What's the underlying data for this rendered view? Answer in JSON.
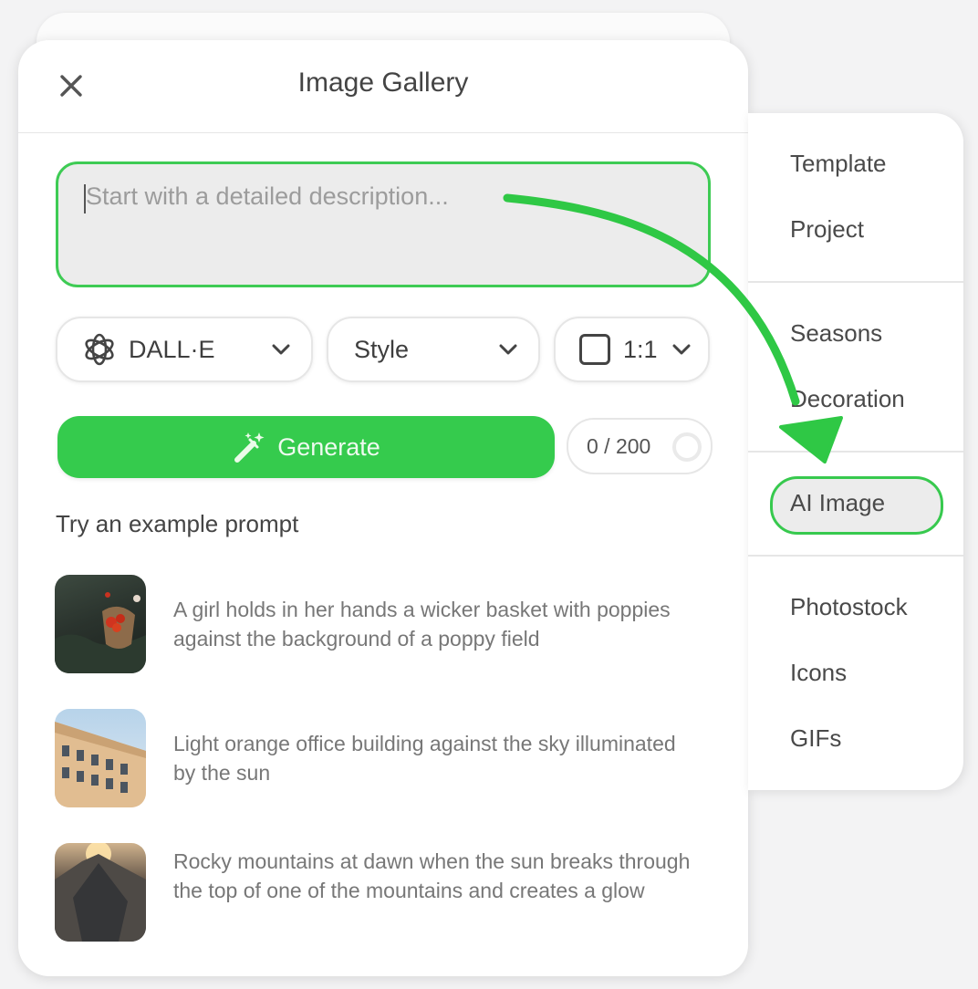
{
  "modal": {
    "title": "Image Gallery",
    "prompt": {
      "placeholder": "Start with a detailed description...",
      "value": ""
    },
    "model_select": {
      "label": "DALL·E",
      "icon": "openai-logo-icon"
    },
    "style_select": {
      "label": "Style"
    },
    "ratio_select": {
      "label": "1:1"
    },
    "generate_button": {
      "label": "Generate",
      "icon": "magic-wand-icon"
    },
    "counter": {
      "label": "0 / 200",
      "used": 0,
      "max": 200
    },
    "examples_heading": "Try an example prompt",
    "examples": [
      {
        "text": "A girl holds in her hands a wicker basket with poppies against the background of a poppy field"
      },
      {
        "text": "Light orange office building against the sky illuminated by the sun"
      },
      {
        "text": "Rocky mountains at dawn when the sun breaks through the top of one of the mountains and creates a glow"
      }
    ]
  },
  "side_menu": {
    "groups": [
      {
        "items": [
          "Template",
          "Project"
        ]
      },
      {
        "items": [
          "Seasons",
          "Decoration"
        ]
      },
      {
        "items": [
          "AI Image"
        ]
      },
      {
        "items": [
          "Photostock",
          "Icons",
          "GIFs"
        ]
      }
    ],
    "active_item": "AI Image"
  },
  "colors": {
    "accent_green": "#35cb4d",
    "annotation_green": "#2fc845",
    "background": "#f3f3f4"
  }
}
